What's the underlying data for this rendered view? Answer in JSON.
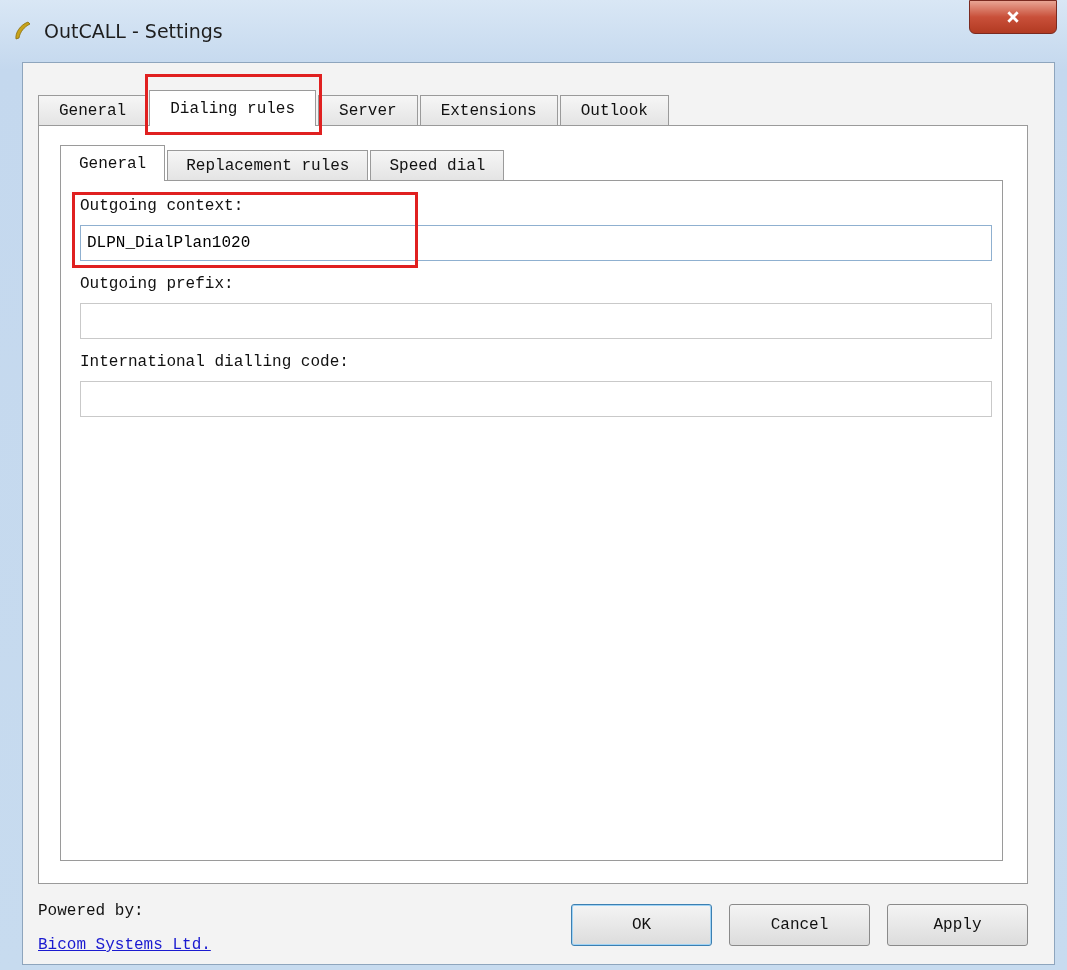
{
  "window": {
    "title": "OutCALL  - Settings"
  },
  "tabs": [
    {
      "label": "General",
      "selected": false,
      "highlighted": false
    },
    {
      "label": "Dialing rules",
      "selected": true,
      "highlighted": true
    },
    {
      "label": "Server",
      "selected": false,
      "highlighted": false
    },
    {
      "label": "Extensions",
      "selected": false,
      "highlighted": false
    },
    {
      "label": "Outlook",
      "selected": false,
      "highlighted": false
    }
  ],
  "subtabs": [
    {
      "label": "General",
      "selected": true
    },
    {
      "label": "Replacement rules",
      "selected": false
    },
    {
      "label": "Speed dial",
      "selected": false
    }
  ],
  "fields": [
    {
      "label": "Outgoing context:",
      "value": "DLPN_DialPlan1020",
      "highlighted": true
    },
    {
      "label": "Outgoing prefix:",
      "highlighted": false
    },
    {
      "label": "International dialling code:",
      "highlighted": false
    }
  ],
  "footer": {
    "powered_by": "Powered by:",
    "link": "Bicom Systems Ltd."
  },
  "buttons": [
    {
      "label": "OK",
      "default": true
    },
    {
      "label": "Cancel",
      "default": false
    },
    {
      "label": "Apply",
      "default": false
    }
  ]
}
